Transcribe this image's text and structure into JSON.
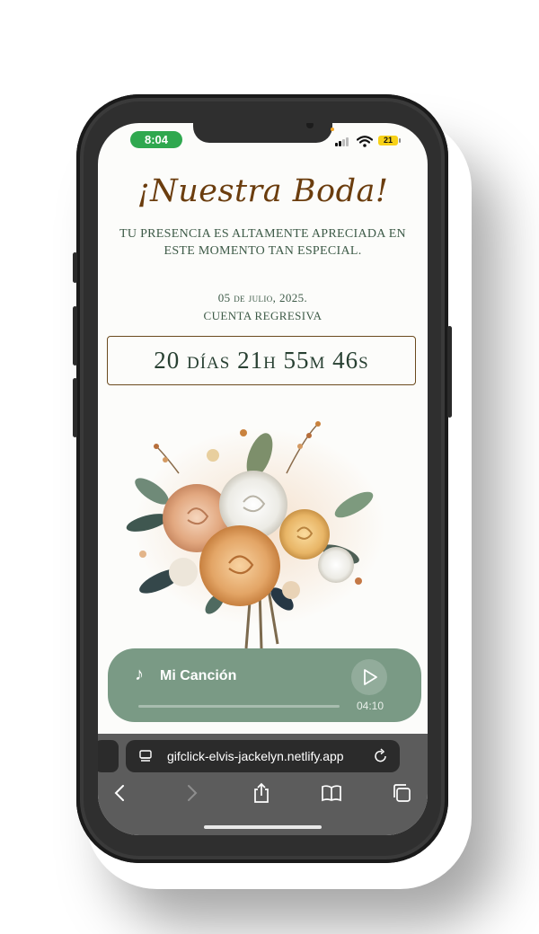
{
  "status_bar": {
    "time": "8:04",
    "battery": "21"
  },
  "invitation": {
    "title": "¡Nuestra Boda!",
    "subtitle": "TU PRESENCIA ES ALTAMENTE APRECIADA EN ESTE MOMENTO TAN ESPECIAL.",
    "date": "05 de julio, 2025.",
    "countdown_label": "CUENTA REGRESIVA",
    "countdown": "20 días 21h 55m 46s"
  },
  "music_player": {
    "song_title": "Mi Canción",
    "duration": "04:10",
    "progress": 0.0,
    "accent_color": "#7a9a85"
  },
  "browser": {
    "url": "gifclick-elvis-jackelyn.netlify.app",
    "toolbar_icons": [
      "back-icon",
      "forward-icon",
      "share-icon",
      "bookmarks-icon",
      "tabs-icon"
    ]
  },
  "colors": {
    "title": "#6b3d0e",
    "text": "#3d5a47",
    "countdown_border": "#6b4a1e",
    "status_time_pill": "#2fa84f"
  }
}
